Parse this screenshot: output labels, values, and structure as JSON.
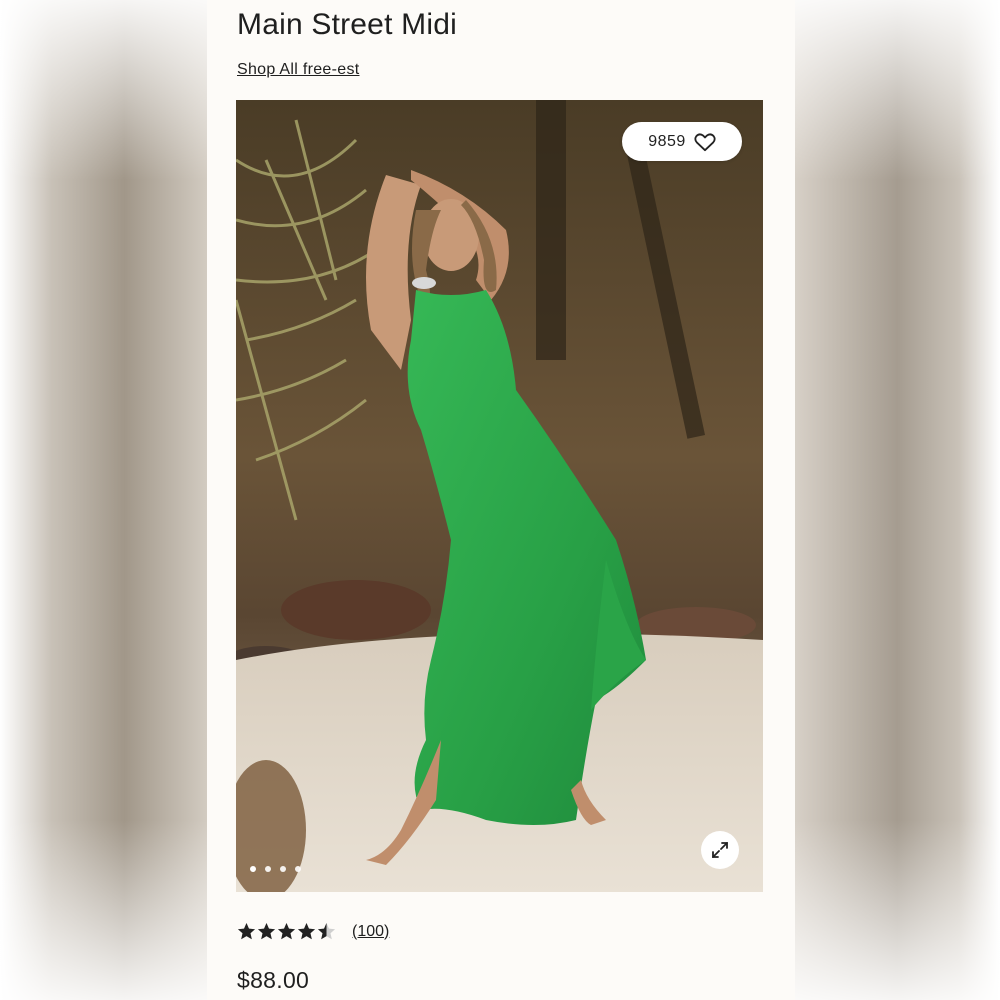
{
  "product": {
    "title": "Main Street Midi",
    "brand_link": "Shop All free-est",
    "price": "$88.00"
  },
  "image": {
    "favorites_count": "9859",
    "carousel_dots": 4,
    "active_dot": 0,
    "dress_color": "#2ea84a"
  },
  "rating": {
    "value": 4.5,
    "max": 5,
    "review_count": "(100)"
  },
  "icons": {
    "favorite": "heart-icon",
    "expand": "expand-arrows-icon",
    "rating": "star-icon"
  }
}
